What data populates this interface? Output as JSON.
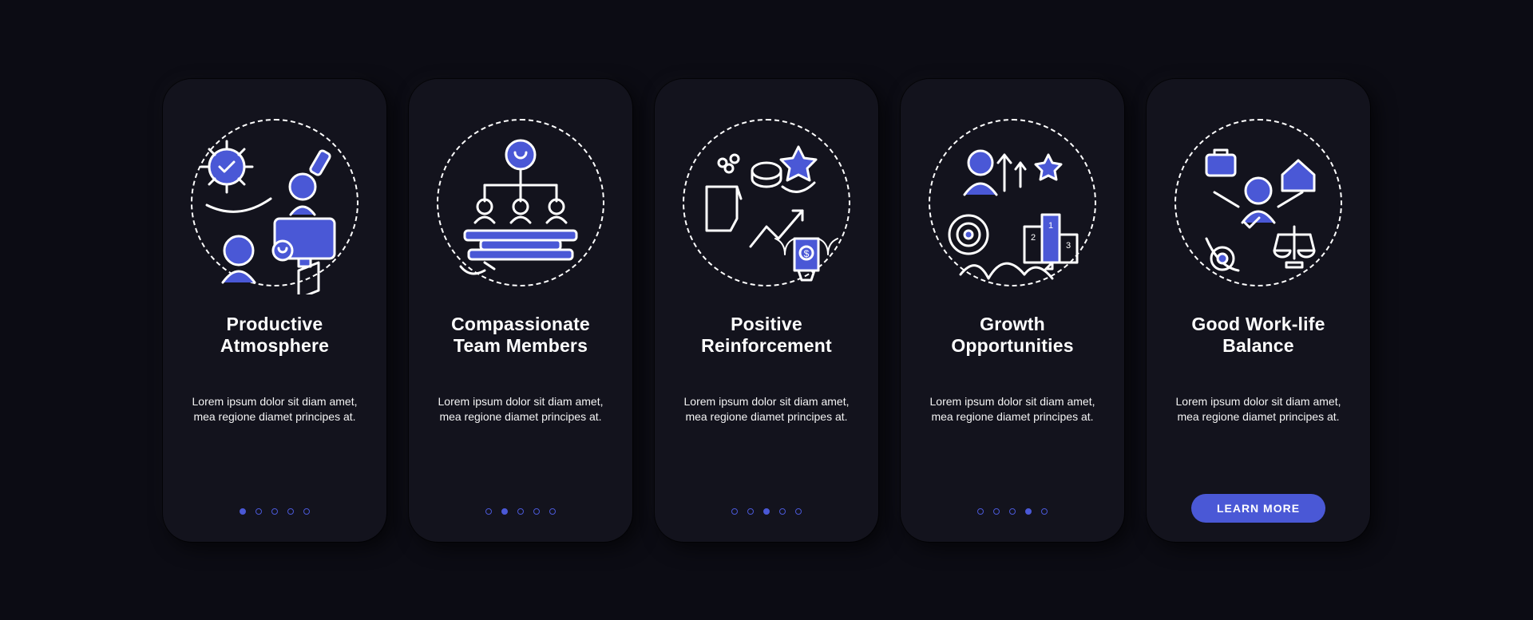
{
  "accent": "#4a58d6",
  "learn_more_label": "LEARN MORE",
  "cards": [
    {
      "title": "Productive\nAtmosphere",
      "desc": "Lorem ipsum dolor sit diam amet, mea regione diamet principes at.",
      "icon": "productive-atmosphere-icon",
      "active_dot": 0
    },
    {
      "title": "Compassionate\nTeam Members",
      "desc": "Lorem ipsum dolor sit diam amet, mea regione diamet principes at.",
      "icon": "compassionate-team-icon",
      "active_dot": 1
    },
    {
      "title": "Positive\nReinforcement",
      "desc": "Lorem ipsum dolor sit diam amet, mea regione diamet principes at.",
      "icon": "positive-reinforcement-icon",
      "active_dot": 2
    },
    {
      "title": "Growth\nOpportunities",
      "desc": "Lorem ipsum dolor sit diam amet, mea regione diamet principes at.",
      "icon": "growth-opportunities-icon",
      "active_dot": 3
    },
    {
      "title": "Good Work-life\nBalance",
      "desc": "Lorem ipsum dolor sit diam amet, mea regione diamet principes at.",
      "icon": "work-life-balance-icon",
      "active_dot": 4
    }
  ]
}
